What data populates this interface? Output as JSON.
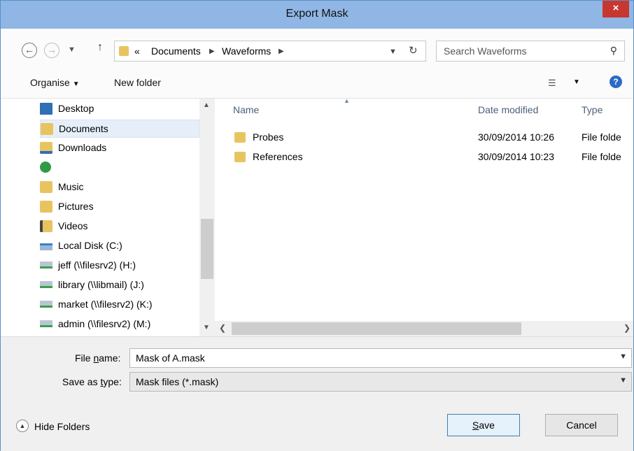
{
  "window": {
    "title": "Export Mask",
    "close_glyph": "×"
  },
  "address": {
    "overflow": "«",
    "crumbs": [
      "Documents",
      "Waveforms"
    ],
    "search_placeholder": "Search Waveforms"
  },
  "toolbar": {
    "organise": "Organise",
    "new_folder": "New folder"
  },
  "nav": {
    "items": [
      {
        "label": "Desktop",
        "icon": "desktop-icon"
      },
      {
        "label": "Documents",
        "icon": "documents-icon",
        "selected": true
      },
      {
        "label": "Downloads",
        "icon": "downloads-icon"
      },
      {
        "label": "",
        "icon": "homegroup-icon"
      },
      {
        "label": "Music",
        "icon": "music-icon"
      },
      {
        "label": "Pictures",
        "icon": "pictures-icon"
      },
      {
        "label": "Videos",
        "icon": "videos-icon"
      },
      {
        "label": "Local Disk (C:)",
        "icon": "local-disk-icon"
      },
      {
        "label": "jeff (\\\\filesrv2) (H:)",
        "icon": "network-drive-icon"
      },
      {
        "label": "library (\\\\libmail) (J:)",
        "icon": "network-drive-icon"
      },
      {
        "label": "market (\\\\filesrv2) (K:)",
        "icon": "network-drive-icon"
      },
      {
        "label": "admin (\\\\filesrv2) (M:)",
        "icon": "network-drive-icon"
      }
    ]
  },
  "files": {
    "columns": {
      "name": "Name",
      "date": "Date modified",
      "type": "Type"
    },
    "rows": [
      {
        "name": "Probes",
        "date": "30/09/2014 10:26",
        "type": "File folde"
      },
      {
        "name": "References",
        "date": "30/09/2014 10:23",
        "type": "File folde"
      }
    ]
  },
  "form": {
    "file_name_label_pre": "File ",
    "file_name_label_ul": "n",
    "file_name_label_post": "ame:",
    "file_name_value": "Mask of A.mask",
    "save_type_label_pre": "Save as ",
    "save_type_label_ul": "t",
    "save_type_label_post": "ype:",
    "save_type_value": "Mask files (*.mask)"
  },
  "footer": {
    "hide_folders": "Hide Folders",
    "save_ul": "S",
    "save_rest": "ave",
    "cancel": "Cancel"
  },
  "colors": {
    "titlebar": "#8fb6e4",
    "close": "#c7372f",
    "folder": "#e8c460",
    "selection": "#e6eff9"
  }
}
